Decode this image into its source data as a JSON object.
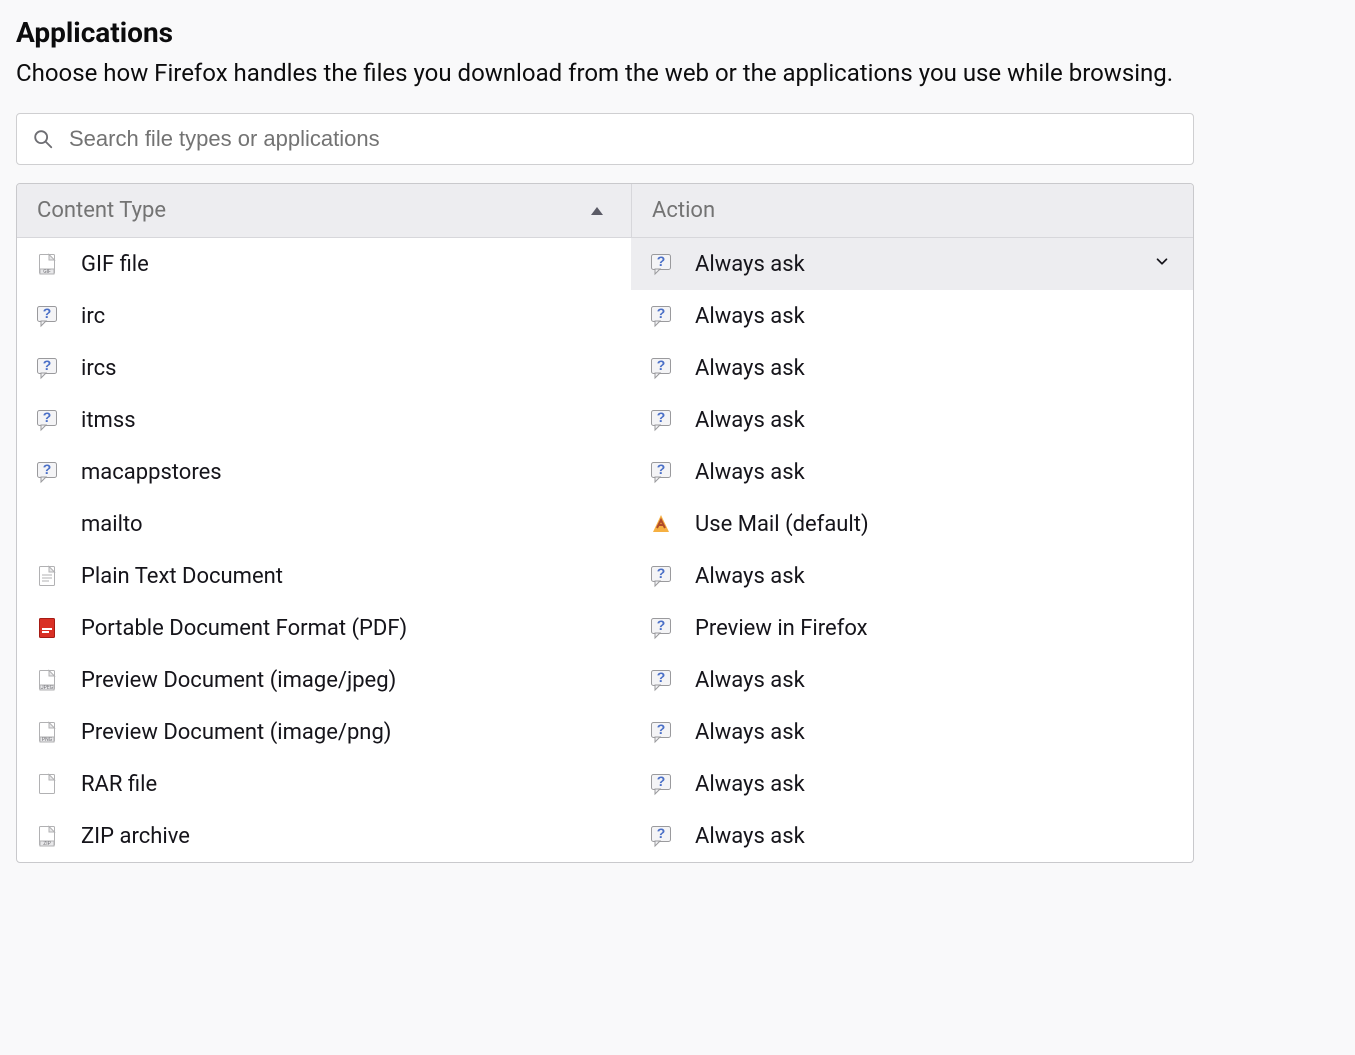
{
  "section": {
    "title": "Applications",
    "description": "Choose how Firefox handles the files you download from the web or the applications you use while browsing."
  },
  "search": {
    "placeholder": "Search file types or applications",
    "value": ""
  },
  "columns": {
    "type": "Content Type",
    "action": "Action"
  },
  "rows": [
    {
      "type_icon": "gif",
      "type_label": "GIF file",
      "action_icon": "ask",
      "action_label": "Always ask",
      "selected": true
    },
    {
      "type_icon": "ask",
      "type_label": "irc",
      "action_icon": "ask",
      "action_label": "Always ask",
      "selected": false
    },
    {
      "type_icon": "ask",
      "type_label": "ircs",
      "action_icon": "ask",
      "action_label": "Always ask",
      "selected": false
    },
    {
      "type_icon": "ask",
      "type_label": "itmss",
      "action_icon": "ask",
      "action_label": "Always ask",
      "selected": false
    },
    {
      "type_icon": "ask",
      "type_label": "macappstores",
      "action_icon": "ask",
      "action_label": "Always ask",
      "selected": false
    },
    {
      "type_icon": "none",
      "type_label": "mailto",
      "action_icon": "mail",
      "action_label": "Use Mail (default)",
      "selected": false
    },
    {
      "type_icon": "txt",
      "type_label": "Plain Text Document",
      "action_icon": "ask",
      "action_label": "Always ask",
      "selected": false
    },
    {
      "type_icon": "pdf",
      "type_label": "Portable Document Format (PDF)",
      "action_icon": "ask",
      "action_label": "Preview in Firefox",
      "selected": false
    },
    {
      "type_icon": "jpeg",
      "type_label": "Preview Document (image/jpeg)",
      "action_icon": "ask",
      "action_label": "Always ask",
      "selected": false
    },
    {
      "type_icon": "png",
      "type_label": "Preview Document (image/png)",
      "action_icon": "ask",
      "action_label": "Always ask",
      "selected": false
    },
    {
      "type_icon": "blank",
      "type_label": "RAR file",
      "action_icon": "ask",
      "action_label": "Always ask",
      "selected": false
    },
    {
      "type_icon": "zip",
      "type_label": "ZIP archive",
      "action_icon": "ask",
      "action_label": "Always ask",
      "selected": false
    }
  ]
}
